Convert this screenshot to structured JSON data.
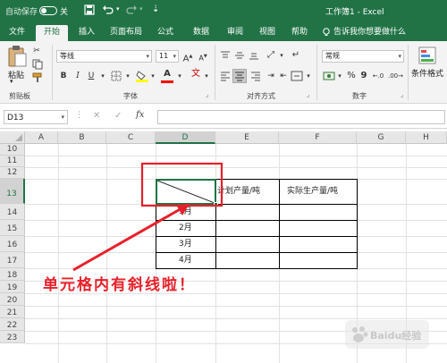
{
  "titlebar": {
    "autosave_label": "自动保存",
    "autosave_state": "关",
    "title": "工作簿1 - Excel",
    "bg": "#217346"
  },
  "tabs": [
    {
      "label": "文件",
      "active": false
    },
    {
      "label": "开始",
      "active": true
    },
    {
      "label": "插入",
      "active": false
    },
    {
      "label": "页面布局",
      "active": false
    },
    {
      "label": "公式",
      "active": false
    },
    {
      "label": "数据",
      "active": false
    },
    {
      "label": "审阅",
      "active": false
    },
    {
      "label": "视图",
      "active": false
    },
    {
      "label": "帮助",
      "active": false
    }
  ],
  "tell_me": "告诉我你想要做什么",
  "ribbon": {
    "paste_label": "粘贴",
    "font_name": "等线",
    "font_size": "11",
    "number_format": "常规",
    "conditional_format_label": "条件格式",
    "groups": {
      "clipboard": "剪贴板",
      "font": "字体",
      "alignment": "对齐方式",
      "number": "数字"
    },
    "font_color": "#ff0000",
    "fill_color": "#ffff00"
  },
  "formula_bar": {
    "name_box": "D13",
    "fx_label": "fx",
    "value": ""
  },
  "sheet": {
    "columns": [
      "A",
      "B",
      "C",
      "D",
      "E",
      "F",
      "G",
      "H"
    ],
    "selected_column": "D",
    "rows": [
      "10",
      "11",
      "12",
      "13",
      "14",
      "15",
      "16",
      "17",
      "18",
      "19",
      "20",
      "21",
      "22",
      "23"
    ],
    "selected_row": "13",
    "table": {
      "headers": [
        "计划产量/吨",
        "实际生产量/吨"
      ],
      "months": [
        "1月",
        "2月",
        "3月",
        "4月"
      ]
    }
  },
  "annotation": {
    "text": "单元格内有斜线啦！",
    "color": "#e8202a"
  },
  "watermark": "Baidu经验"
}
